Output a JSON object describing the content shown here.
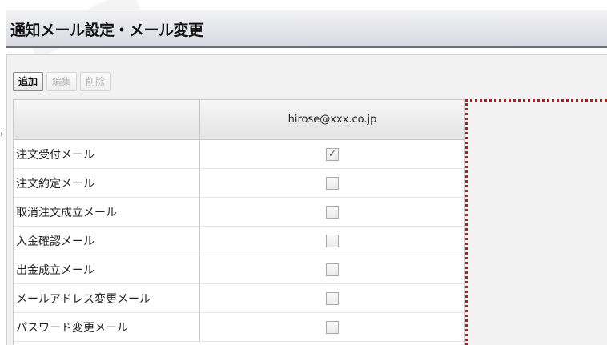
{
  "page": {
    "title": "通知メール設定・メール変更"
  },
  "toolbar": {
    "add_label": "追加",
    "edit_label": "編集",
    "delete_label": "削除"
  },
  "grid": {
    "header": {
      "name": "",
      "email": "hirose@xxx.co.jp"
    },
    "rows": [
      {
        "label": "注文受付メール",
        "checked": true
      },
      {
        "label": "注文約定メール",
        "checked": false
      },
      {
        "label": "取消注文成立メール",
        "checked": false
      },
      {
        "label": "入金確認メール",
        "checked": false
      },
      {
        "label": "出金成立メール",
        "checked": false
      },
      {
        "label": "メールアドレス変更メール",
        "checked": false
      },
      {
        "label": "パスワード変更メール",
        "checked": false
      }
    ]
  },
  "icons": {
    "left_arrow": "chevron-right-icon",
    "check": "checkmark-icon"
  },
  "colors": {
    "title_border": "#6d6d7c",
    "highlight_frame": "#cc1111"
  }
}
